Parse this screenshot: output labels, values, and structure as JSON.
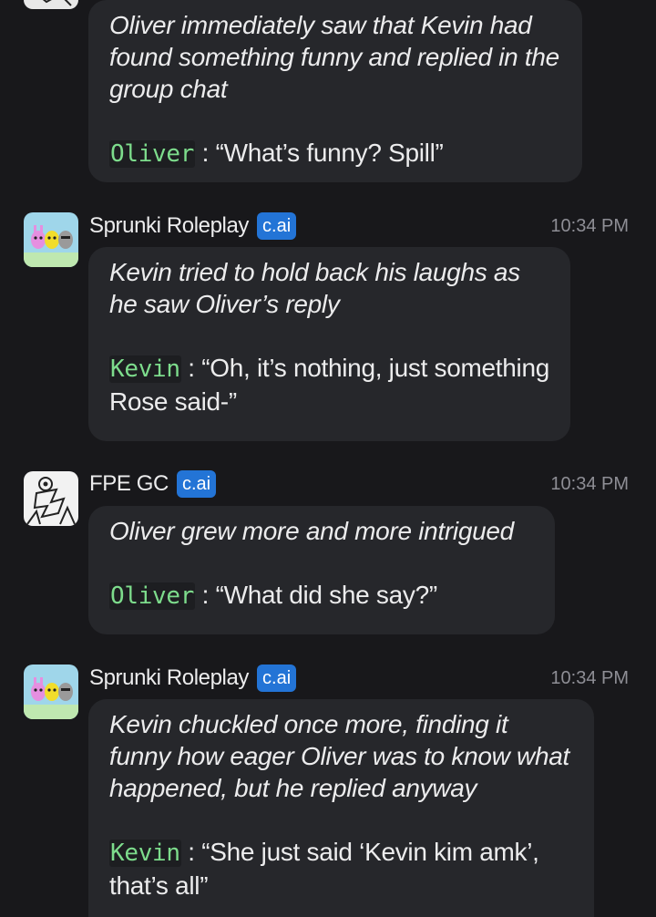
{
  "messages": [
    {
      "sender": "",
      "badge": "",
      "time": "",
      "narration": "Oliver immediately saw that Kevin had found something funny and replied in the group chat",
      "speaker": "Oliver",
      "separator": " : ",
      "quote": "“What’s funny? Spill”"
    },
    {
      "sender": "Sprunki Roleplay",
      "badge": "c.ai",
      "time": "10:34 PM",
      "avatar_icon": "sprunki-avatar-icon",
      "narration": "Kevin tried to hold back his laughs as he saw Oliver’s reply",
      "speaker": "Kevin",
      "separator": " : ",
      "quote": "“Oh, it’s nothing, just something Rose said-”"
    },
    {
      "sender": "FPE GC",
      "badge": "c.ai",
      "time": "10:34 PM",
      "avatar_icon": "sketch-avatar-icon",
      "narration": "Oliver grew more and more intrigued",
      "speaker": "Oliver",
      "separator": " : ",
      "quote": "“What did she say?”"
    },
    {
      "sender": "Sprunki Roleplay",
      "badge": "c.ai",
      "time": "10:34 PM",
      "avatar_icon": "sprunki-avatar-icon",
      "narration": "Kevin chuckled once more, finding it funny how eager Oliver was to know what happened, but he replied anyway",
      "speaker": "Kevin",
      "separator": " : ",
      "quote": "“She just said ‘Kevin kim amk’, that’s all”"
    }
  ],
  "colors": {
    "background": "#18181b",
    "bubble": "#26272b",
    "badge": "#2374d6",
    "speaker_name": "#7ddc8c",
    "timestamp": "#8e8e95"
  }
}
